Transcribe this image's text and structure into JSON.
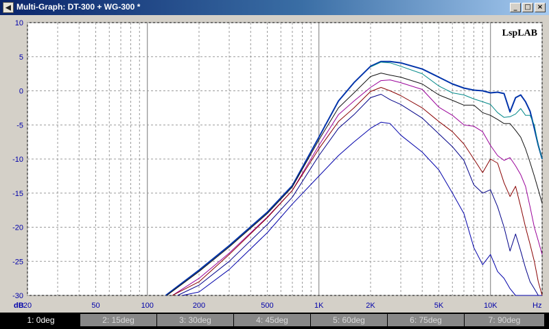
{
  "window": {
    "title": "Multi-Graph: DT-300 + WG-300 *",
    "app_icon": "speaker-icon",
    "buttons": {
      "minimize": "_",
      "maximize": "□",
      "close": "×"
    }
  },
  "tabs": [
    {
      "label": "1: 0deg",
      "active": true
    },
    {
      "label": "2: 15deg",
      "active": false
    },
    {
      "label": "3: 30deg",
      "active": false
    },
    {
      "label": "4: 45deg",
      "active": false
    },
    {
      "label": "5: 60deg",
      "active": false
    },
    {
      "label": "6: 75deg",
      "active": false
    },
    {
      "label": "7: 90deg",
      "active": false
    }
  ],
  "chart_data": {
    "type": "line",
    "xscale": "log",
    "xlim": [
      20,
      20000
    ],
    "ylim": [
      -30,
      10
    ],
    "xunit": "Hz",
    "yunit": "dB",
    "watermark": "LspLAB",
    "grid": true,
    "x_tick_labels": [
      {
        "v": 20,
        "label": "20"
      },
      {
        "v": 50,
        "label": "50"
      },
      {
        "v": 100,
        "label": "100"
      },
      {
        "v": 200,
        "label": "200"
      },
      {
        "v": 500,
        "label": "500"
      },
      {
        "v": 1000,
        "label": "1K"
      },
      {
        "v": 2000,
        "label": "2K"
      },
      {
        "v": 5000,
        "label": "5K"
      },
      {
        "v": 10000,
        "label": "10K"
      }
    ],
    "y_ticks": [
      10,
      5,
      0,
      -5,
      -10,
      -15,
      -20,
      -25,
      -30
    ],
    "series": [
      {
        "color": "#0033aa",
        "width": 2,
        "x": [
          128,
          200,
          300,
          500,
          700,
          1000,
          1300,
          1600,
          2000,
          2300,
          2600,
          3000,
          4000,
          5000,
          6000,
          7000,
          8000,
          9000,
          10000,
          11000,
          12000,
          13000,
          14000,
          15000,
          16000,
          17000,
          18000,
          19000,
          20000
        ],
        "y": [
          -30,
          -26.3,
          -22.7,
          -17.8,
          -13.9,
          -6.8,
          -1.5,
          1.2,
          3.6,
          4.3,
          4.3,
          4.1,
          3.2,
          2.0,
          1.0,
          0.4,
          0.1,
          0.0,
          -0.3,
          -0.2,
          -0.4,
          -3.1,
          -1.0,
          -0.6,
          -1.6,
          -3.0,
          -5.5,
          -8.0,
          -10.0
        ]
      },
      {
        "color": "#008888",
        "width": 1,
        "x": [
          2000,
          2300,
          2600,
          3000,
          4000,
          5000,
          6000,
          7000,
          8000,
          9000,
          10000,
          11000,
          12000,
          13000,
          14000,
          15000,
          16000,
          17000,
          18000,
          19000,
          20000
        ],
        "y": [
          3.5,
          4.2,
          4.1,
          3.6,
          2.5,
          0.7,
          -0.3,
          -0.6,
          -1.2,
          -1.6,
          -2.0,
          -3.2,
          -3.9,
          -3.8,
          -3.4,
          -2.6,
          -3.6,
          -3.6,
          -5.0,
          -8.0,
          -10.0
        ]
      },
      {
        "color": "#111111",
        "width": 1,
        "x": [
          130,
          200,
          300,
          500,
          700,
          1000,
          1300,
          1600,
          2000,
          2300,
          2600,
          3000,
          4000,
          5000,
          6000,
          7000,
          8000,
          9000,
          10000,
          11000,
          12000,
          13000,
          14000,
          15000,
          16000,
          17000,
          18000,
          19000,
          20000
        ],
        "y": [
          -30,
          -26.5,
          -22.9,
          -18.0,
          -14.1,
          -7.2,
          -2.5,
          -0.3,
          2.1,
          2.6,
          2.3,
          2.0,
          1.0,
          -0.6,
          -1.4,
          -2.1,
          -2.1,
          -3.2,
          -3.6,
          -4.2,
          -4.8,
          -4.8,
          -5.8,
          -6.8,
          -8.5,
          -10.5,
          -12.5,
          -14.5,
          -16.5
        ]
      },
      {
        "color": "#990099",
        "width": 1,
        "x": [
          140,
          200,
          300,
          500,
          700,
          1000,
          1300,
          1600,
          2000,
          2300,
          2600,
          3000,
          4000,
          5000,
          6000,
          7000,
          8000,
          9000,
          10000,
          11000,
          12000,
          13000,
          14000,
          15000,
          16000,
          17000,
          18000,
          19000,
          20000
        ],
        "y": [
          -30,
          -27.5,
          -23.8,
          -18.5,
          -14.6,
          -8.0,
          -3.5,
          -1.5,
          0.5,
          1.5,
          1.6,
          1.2,
          0.2,
          -2.4,
          -3.6,
          -5.0,
          -5.2,
          -6.0,
          -8.0,
          -9.5,
          -10.2,
          -9.8,
          -11.0,
          -12.3,
          -14.0,
          -17.0,
          -20.0,
          -22.0,
          -24.0
        ]
      },
      {
        "color": "#880000",
        "width": 1,
        "x": [
          140,
          200,
          300,
          500,
          700,
          1000,
          1300,
          1600,
          2000,
          2300,
          2600,
          3000,
          4000,
          5000,
          6000,
          7000,
          8000,
          9000,
          10000,
          11000,
          12000,
          13000,
          14000,
          15000,
          16000,
          17000,
          18000,
          19000,
          20000
        ],
        "y": [
          -30,
          -28.0,
          -24.0,
          -18.6,
          -14.6,
          -8.5,
          -4.5,
          -2.5,
          -0.1,
          0.5,
          0.0,
          -0.7,
          -2.5,
          -4.5,
          -6.0,
          -7.8,
          -10.0,
          -12.0,
          -10.0,
          -10.6,
          -13.5,
          -15.5,
          -14.0,
          -17.0,
          -20.0,
          -22.5,
          -25.0,
          -28.0,
          -30.0
        ]
      },
      {
        "color": "#000088",
        "width": 1,
        "x": [
          150,
          200,
          300,
          500,
          700,
          1000,
          1300,
          1600,
          2000,
          2300,
          2600,
          3000,
          4000,
          5000,
          6000,
          7000,
          8000,
          9000,
          10000,
          11000,
          12000,
          13000,
          14000,
          15000,
          16000,
          17000,
          18000,
          19000,
          20000
        ],
        "y": [
          -30,
          -28.5,
          -25.0,
          -19.6,
          -15.6,
          -9.5,
          -5.5,
          -3.5,
          -1.0,
          -0.5,
          -1.3,
          -2.0,
          -4.0,
          -6.3,
          -8.2,
          -10.2,
          -13.8,
          -15.0,
          -14.5,
          -17.0,
          -20.0,
          -23.5,
          -21.0,
          -23.5,
          -26.0,
          -28.0,
          -29.0,
          -30.0,
          -30.0
        ]
      },
      {
        "color": "#0000aa",
        "width": 1,
        "x": [
          160,
          200,
          300,
          500,
          700,
          1000,
          1300,
          1600,
          2000,
          2300,
          2600,
          3000,
          4000,
          5000,
          6000,
          7000,
          8000,
          9000,
          10000,
          11000,
          12000,
          13000,
          14000,
          15000,
          16000,
          17000,
          18000,
          19000,
          20000
        ],
        "y": [
          -30,
          -29.5,
          -26.2,
          -20.8,
          -16.6,
          -12.5,
          -9.5,
          -7.5,
          -5.5,
          -4.6,
          -4.8,
          -6.5,
          -9.0,
          -11.6,
          -15.0,
          -18.0,
          -23.0,
          -25.5,
          -24.0,
          -26.5,
          -27.5,
          -29.0,
          -30.0,
          -30.0,
          -30.0,
          -30.0,
          -30.0,
          -30.0,
          -30.0
        ]
      }
    ]
  }
}
